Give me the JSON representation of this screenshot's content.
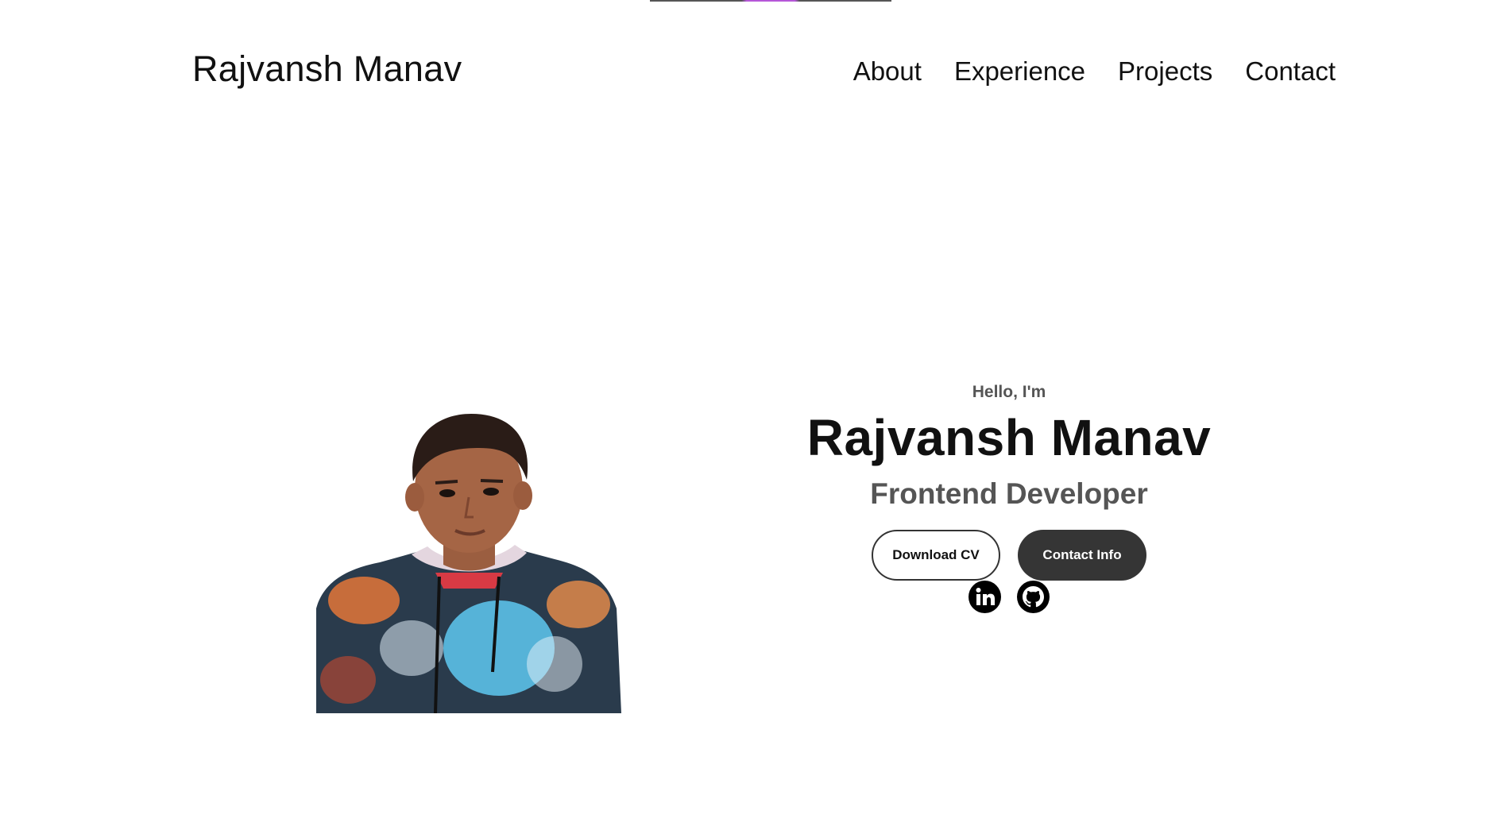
{
  "header": {
    "logo": "Rajvansh Manav",
    "nav": [
      {
        "label": "About"
      },
      {
        "label": "Experience"
      },
      {
        "label": "Projects"
      },
      {
        "label": "Contact"
      }
    ]
  },
  "hero": {
    "greeting": "Hello, I'm",
    "name": "Rajvansh Manav",
    "role": "Frontend Developer",
    "buttons": {
      "download_cv": "Download CV",
      "contact_info": "Contact Info"
    },
    "profile_image": "profile-photo",
    "socials": [
      {
        "icon": "linkedin-icon"
      },
      {
        "icon": "github-icon"
      }
    ]
  },
  "colors": {
    "text_primary": "#111111",
    "text_secondary": "#555555",
    "button_dark": "#353535",
    "accent_line": "#b657d8"
  }
}
